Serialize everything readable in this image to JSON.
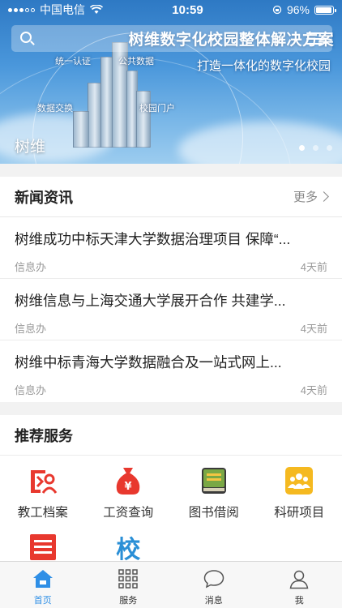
{
  "status_bar": {
    "carrier": "中国电信",
    "time": "10:59",
    "battery": "96%",
    "battery_level": 0.96
  },
  "banner": {
    "title": "树维数字化校园整体解决方案",
    "subtitle": "打造一体化的数字化校园",
    "nodes": [
      "统一认证",
      "公共数据",
      "数据交换",
      "校园门户"
    ],
    "caption": "树维",
    "slide_count": 3,
    "active_slide": 1
  },
  "search": {
    "placeholder": ""
  },
  "news": {
    "title": "新闻资讯",
    "more_label": "更多",
    "items": [
      {
        "title": "树维成功中标天津大学数据治理项目 保障“...",
        "source": "信息办",
        "time": "4天前"
      },
      {
        "title": "树维信息与上海交通大学展开合作 共建学...",
        "source": "信息办",
        "time": "4天前"
      },
      {
        "title": "树维中标青海大学数据融合及一站式网上...",
        "source": "信息办",
        "time": "4天前"
      }
    ]
  },
  "services": {
    "title": "推荐服务",
    "items": [
      {
        "label": "教工档案",
        "icon": "staff-archive-icon"
      },
      {
        "label": "工资查询",
        "icon": "salary-bag-icon"
      },
      {
        "label": "图书借阅",
        "icon": "book-icon"
      },
      {
        "label": "科研项目",
        "icon": "research-team-icon"
      },
      {
        "label": "",
        "icon": "list-icon"
      },
      {
        "label": "",
        "icon": "school-icon",
        "glyph": "校"
      }
    ]
  },
  "tabbar": {
    "items": [
      {
        "label": "首页",
        "icon": "home-icon",
        "active": true
      },
      {
        "label": "服务",
        "icon": "grid-icon",
        "active": false
      },
      {
        "label": "消息",
        "icon": "message-icon",
        "active": false
      },
      {
        "label": "我",
        "icon": "user-icon",
        "active": false
      }
    ]
  },
  "colors": {
    "accent": "#2f8fe6",
    "red_icon": "#e8382e",
    "yellow_icon": "#f5b920",
    "green_book": "#5a8f3a"
  }
}
